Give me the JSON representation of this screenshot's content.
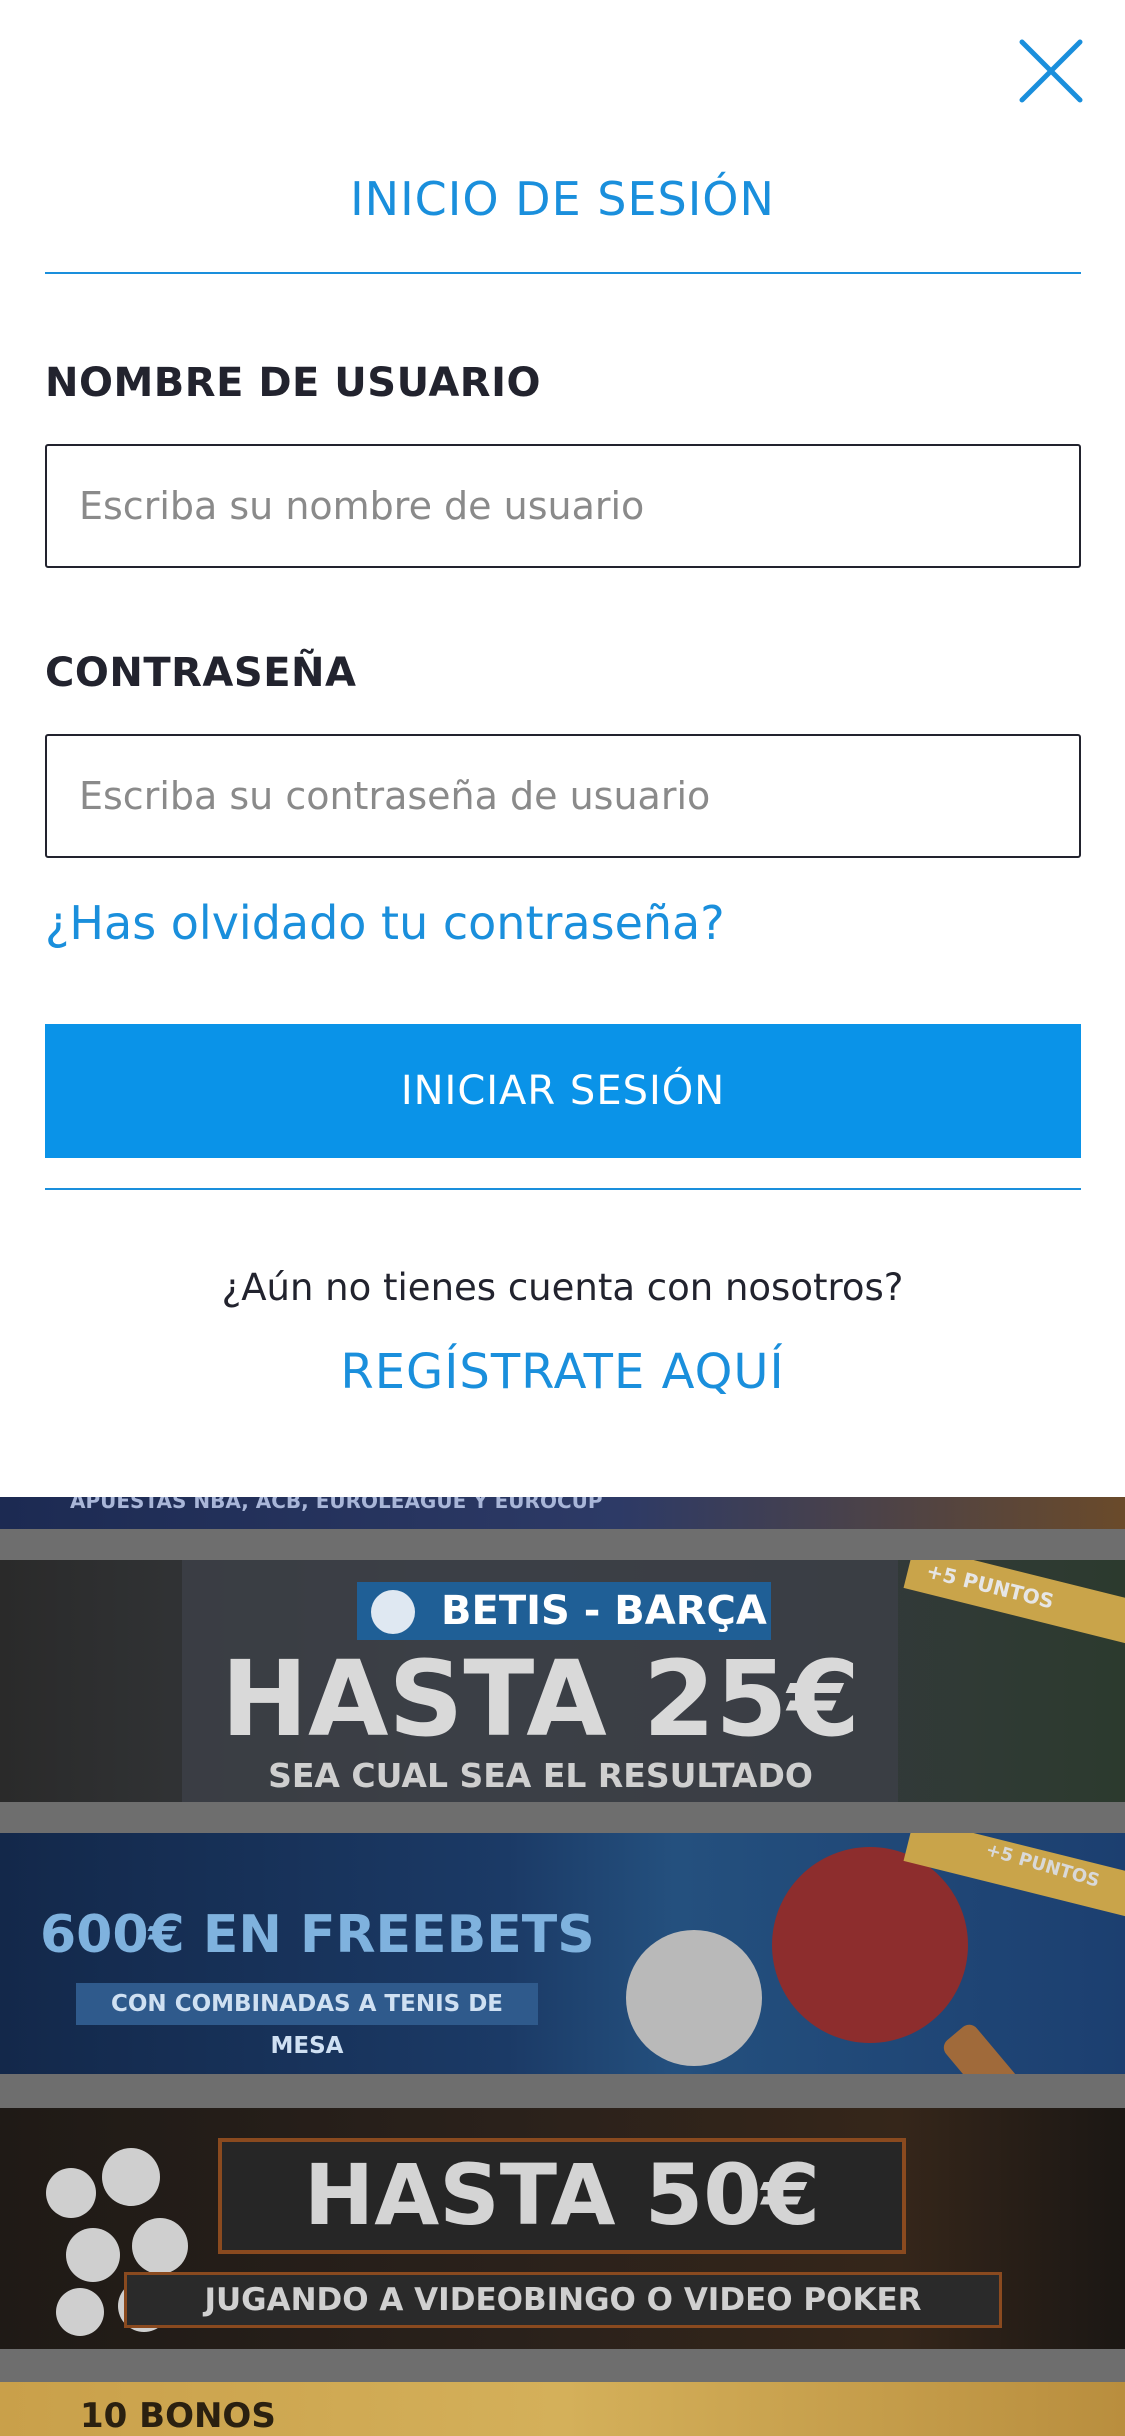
{
  "modal": {
    "title": "INICIO DE SESIÓN",
    "username": {
      "label": "NOMBRE DE USUARIO",
      "placeholder": "Escriba su nombre de usuario",
      "value": ""
    },
    "password": {
      "label": "CONTRASEÑA",
      "placeholder": "Escriba su contraseña de usuario",
      "value": ""
    },
    "forgot_password": "¿Has olvidado tu contraseña?",
    "login_button": "INICIAR SESIÓN",
    "no_account": "¿Aún no tienes cuenta con nosotros?",
    "register_link": "REGÍSTRATE AQUÍ"
  },
  "banners": [
    {
      "text": "APUESTAS NBA, ACB, EUROLEAGUE Y EUROCUP"
    },
    {
      "tag": "BETIS - BARÇA",
      "headline": "HASTA 25€",
      "subtitle": "SEA CUAL SEA EL RESULTADO",
      "badge": "+5 PUNTOS"
    },
    {
      "headline": "600€ EN FREEBETS",
      "subtitle": "CON COMBINADAS A TENIS DE MESA",
      "badge": "+5 PUNTOS"
    },
    {
      "headline": "HASTA 50€",
      "subtitle": "JUGANDO A VIDEOBINGO O VIDEO POKER"
    },
    {
      "headline": "10 BONOS"
    }
  ],
  "colors": {
    "accent": "#1a8fdc",
    "button": "#0a93e8",
    "text": "#22232e",
    "placeholder": "#8a8a8a"
  },
  "icons": {
    "close": "close-icon"
  }
}
